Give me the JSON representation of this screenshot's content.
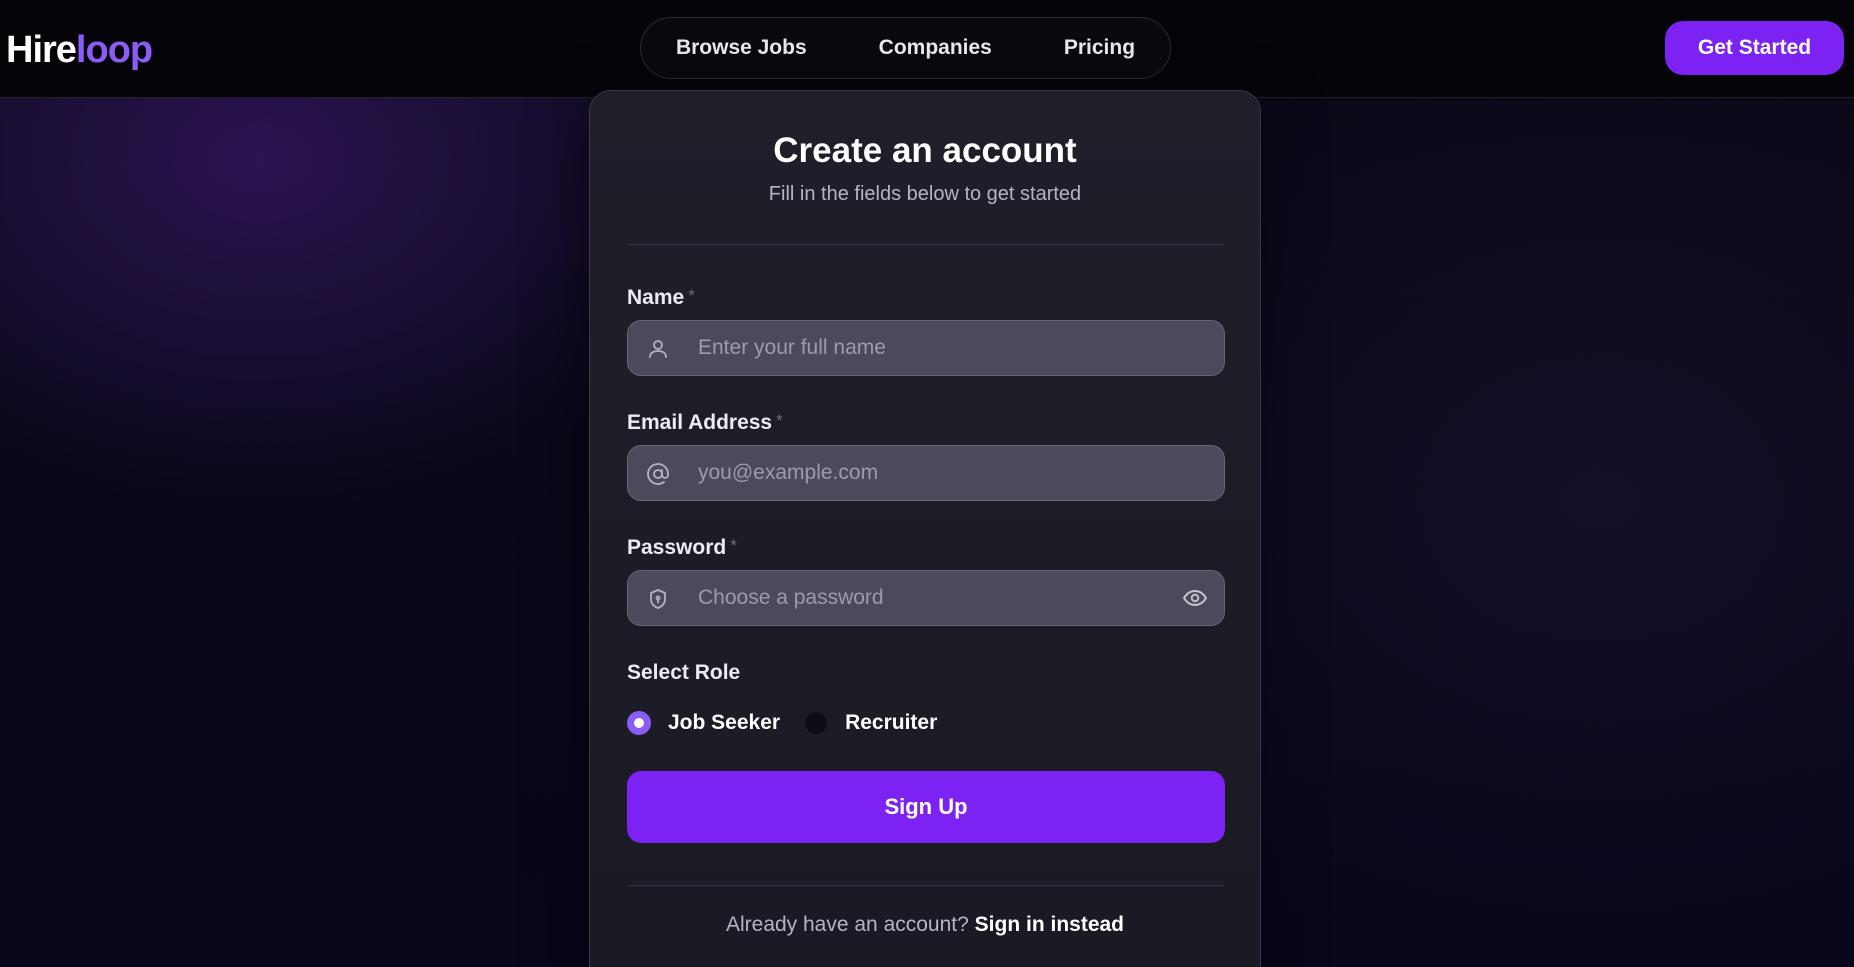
{
  "brand": {
    "name_part1": "Hire",
    "name_part2": "loop",
    "accent_color": "#8b5cf6"
  },
  "nav": {
    "links": [
      {
        "label": "Browse Jobs"
      },
      {
        "label": "Companies"
      },
      {
        "label": "Pricing"
      }
    ],
    "cta_label": "Get Started",
    "cta_color": "#7c22f2"
  },
  "form": {
    "title": "Create an account",
    "subtitle": "Fill in the fields below to get started",
    "required_marker": "*",
    "name": {
      "label": "Name",
      "value": "",
      "placeholder": "Enter your full name",
      "icon": "user-icon"
    },
    "email": {
      "label": "Email Address",
      "value": "",
      "placeholder": "you@example.com",
      "icon": "at-sign-icon"
    },
    "password": {
      "label": "Password",
      "value": "",
      "placeholder": "Choose a password",
      "icon": "shield-icon",
      "toggle_icon": "eye-icon"
    },
    "role": {
      "label": "Select Role",
      "options": [
        {
          "label": "Job Seeker",
          "selected": true
        },
        {
          "label": "Recruiter",
          "selected": false
        }
      ]
    },
    "submit_label": "Sign Up",
    "footer": {
      "prompt": "Already have an account?",
      "link": "Sign in instead"
    }
  }
}
